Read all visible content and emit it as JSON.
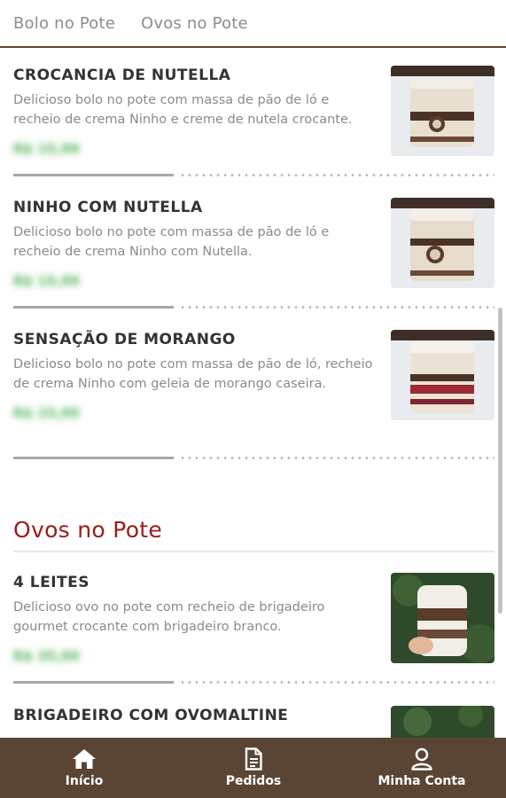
{
  "tabs": [
    {
      "label": "Bolo no Pote"
    },
    {
      "label": "Ovos no Pote"
    }
  ],
  "products": [
    {
      "name": "CROCANCIA DE NUTELLA",
      "description": "Delicioso bolo no pote com massa de pão de ló e recheio de crema Ninho e creme de nutela crocante.",
      "price": "R$ 15,99",
      "image_icon": "cake-jar-photo"
    },
    {
      "name": "NINHO COM NUTELLA",
      "description": "Delicioso bolo no pote com massa de pão de ló e recheio de crema Ninho com Nutella.",
      "price": "R$ 15,99",
      "image_icon": "cake-jar-photo"
    },
    {
      "name": "SENSAÇÃO DE MORANGO",
      "description": "Delicioso bolo no pote com massa de pão de ló, recheio de crema Ninho com geleia de morango caseira.",
      "price": "R$ 15,99",
      "image_icon": "strawberry-cake-jar-photo"
    },
    {
      "name": "4 LEITES",
      "description": "Delicioso ovo no pote com recheio de brigadeiro gourmet crocante com brigadeiro branco.",
      "price": "R$ 35,99",
      "image_icon": "egg-jar-photo"
    },
    {
      "name": "BRIGADEIRO COM OVOMALTINE",
      "image_icon": "egg-jar-photo"
    }
  ],
  "section": {
    "title": "Ovos no Pote"
  },
  "bottom_nav": [
    {
      "label": "Início",
      "icon": "home-icon"
    },
    {
      "label": "Pedidos",
      "icon": "document-icon"
    },
    {
      "label": "Minha Conta",
      "icon": "user-icon"
    }
  ],
  "colors": {
    "brand_brown": "#5a4535",
    "section_red": "#9a1b1b",
    "price_green": "#4caf50"
  }
}
